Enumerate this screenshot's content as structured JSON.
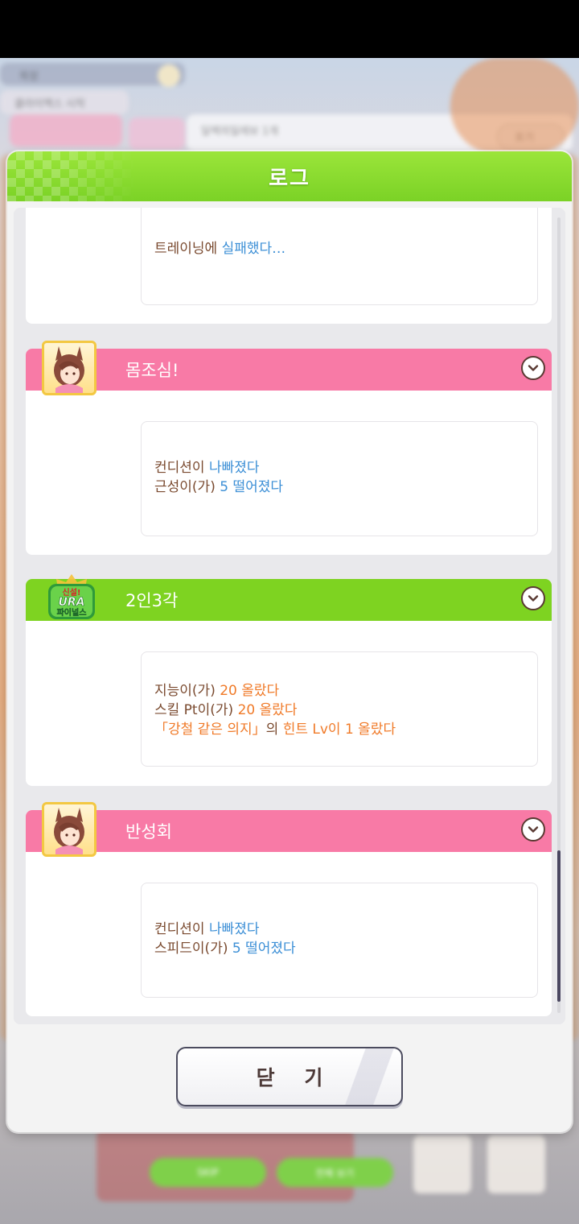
{
  "background": {
    "texts": [
      "목장",
      "클라이맥스 시작",
      "달렉의일레보 1개",
      "포기"
    ],
    "bottom_buttons": [
      "SKIP",
      "전체 보기"
    ]
  },
  "dialog": {
    "title": "로그",
    "entries": [
      {
        "type": "plain",
        "lines": [
          [
            {
              "t": "트레이닝에 ",
              "c": "brown"
            },
            {
              "t": "실패했다…",
              "c": "blue"
            }
          ]
        ]
      },
      {
        "type": "pink",
        "icon": "character-portrait",
        "title": "몸조심!",
        "lines": [
          [
            {
              "t": "컨디션이 ",
              "c": "brown"
            },
            {
              "t": "나빠졌다",
              "c": "blue"
            }
          ],
          [
            {
              "t": "근성이(가) ",
              "c": "brown"
            },
            {
              "t": "5 떨어졌다",
              "c": "blue"
            }
          ]
        ]
      },
      {
        "type": "green",
        "icon": "ura-finals-badge",
        "badge_text": [
          "신설!",
          "URA",
          "파이널스"
        ],
        "title": "2인3각",
        "lines": [
          [
            {
              "t": "지능이(가) ",
              "c": "brown"
            },
            {
              "t": "20 올랐다",
              "c": "orange"
            }
          ],
          [
            {
              "t": "스킬 Pt이(가) ",
              "c": "brown"
            },
            {
              "t": "20 올랐다",
              "c": "orange"
            }
          ],
          [
            {
              "t": "「강철 같은 의지」",
              "c": "orange"
            },
            {
              "t": "의 ",
              "c": "brown"
            },
            {
              "t": "힌트 Lv이 1 올랐다",
              "c": "orange"
            }
          ]
        ]
      },
      {
        "type": "pink",
        "icon": "character-portrait",
        "title": "반성회",
        "lines": [
          [
            {
              "t": "컨디션이 ",
              "c": "brown"
            },
            {
              "t": "나빠졌다",
              "c": "blue"
            }
          ],
          [
            {
              "t": "스피드이(가) ",
              "c": "brown"
            },
            {
              "t": "5 떨어졌다",
              "c": "blue"
            }
          ]
        ]
      }
    ],
    "close_label": "닫 기"
  },
  "colors": {
    "header_green": "#7bd226",
    "banner_pink": "#f87aa6",
    "banner_green": "#7ed321",
    "text_brown": "#7a4a2f",
    "text_blue": "#3c8fd6",
    "text_orange": "#f07a28"
  }
}
